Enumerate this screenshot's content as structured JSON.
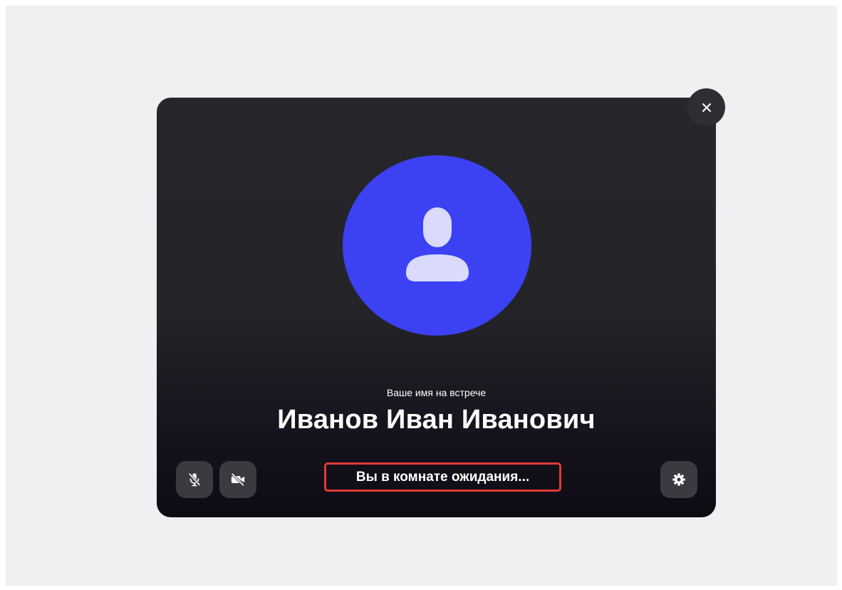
{
  "meeting": {
    "name_caption": "Ваше имя на встрече",
    "user_name": "Иванов Иван Иванович",
    "status": "Вы в комнате ожидания..."
  },
  "controls": {
    "microphone": {
      "icon": "microphone-off-icon",
      "state": "off"
    },
    "camera": {
      "icon": "camera-off-icon",
      "state": "off"
    },
    "settings": {
      "icon": "gear-icon"
    },
    "close": {
      "icon": "close-icon"
    }
  },
  "colors": {
    "page_background": "#eef0f2",
    "card_background": "#232328",
    "avatar_background": "#3c41f4",
    "avatar_figure": "#d9dafc",
    "highlight_border": "#e03a35",
    "control_background": "#3a3a40"
  }
}
